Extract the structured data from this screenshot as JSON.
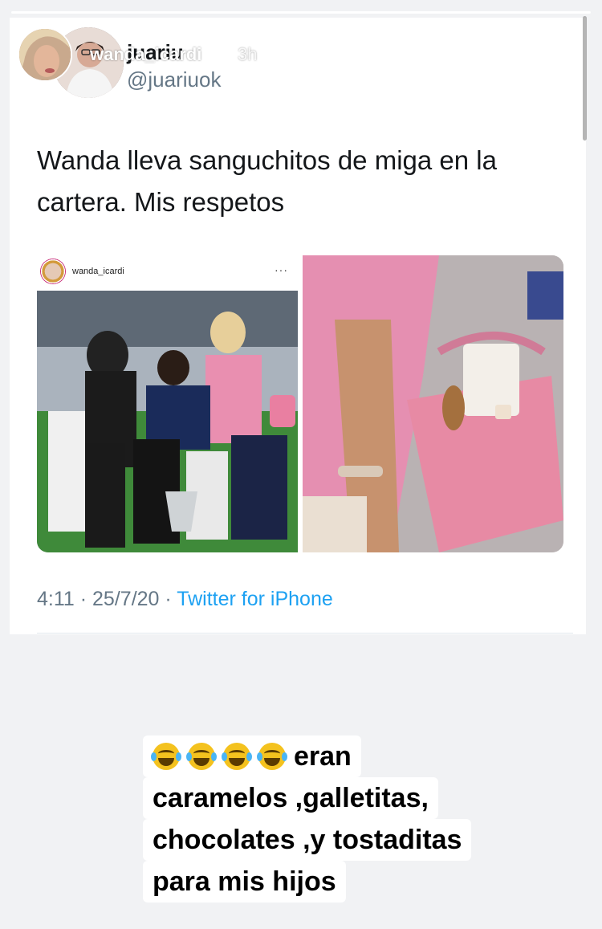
{
  "story": {
    "username": "wanda_icardi",
    "time_ago": "3h",
    "close_icon": "close-icon"
  },
  "tweet": {
    "name": "juariu",
    "handle": "@juariuok",
    "text": "Wanda lleva sanguchitos de miga en la cartera. Mis respetos",
    "embedded_post": {
      "username": "wanda_icardi",
      "more": "···"
    },
    "time": "4:11",
    "date": "25/7/20",
    "source": "Twitter for iPhone",
    "separator": " · "
  },
  "caption": {
    "emoji": "face-with-tears-of-joy-emoji",
    "emoji_count": 4,
    "line1": "eran",
    "line2": "caramelos ,galletitas,",
    "line3": "chocolates ,y tostaditas",
    "line4": "para mis hijos"
  }
}
